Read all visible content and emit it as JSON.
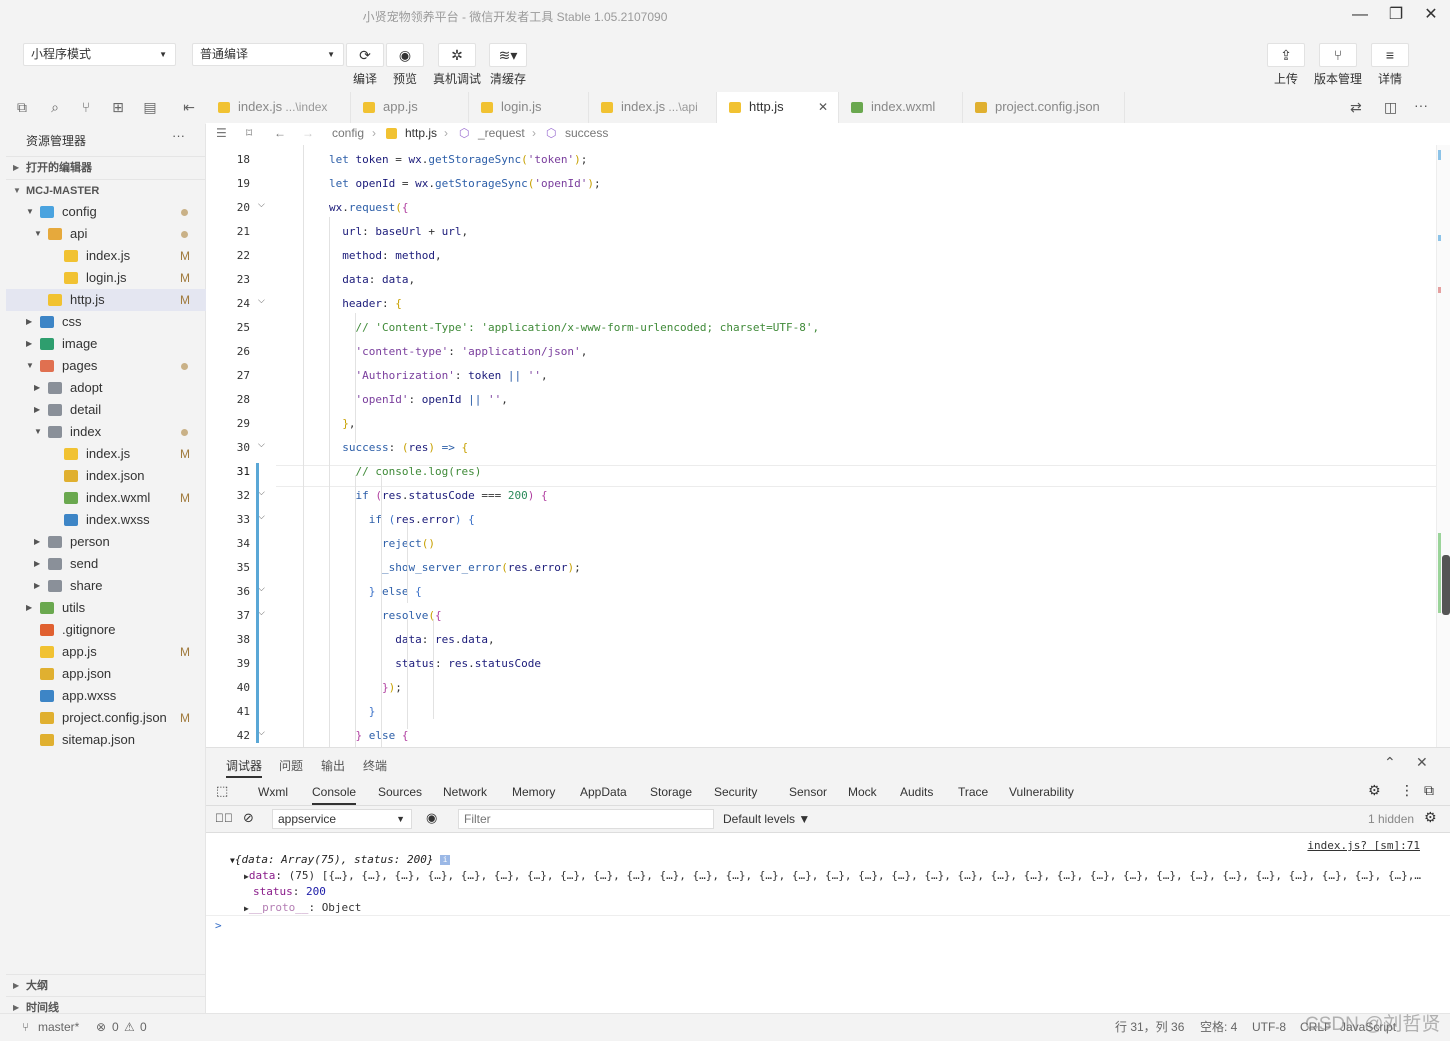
{
  "window": {
    "title": "小贤宠物领养平台 - 微信开发者工具 Stable 1.05.2107090"
  },
  "toolbar": {
    "mode_select": "小程序模式",
    "compile_select": "普通编译",
    "buttons": [
      {
        "label": "编译",
        "icon": "refresh-icon"
      },
      {
        "label": "预览",
        "icon": "eye-icon"
      },
      {
        "label": "真机调试",
        "icon": "bug-icon"
      },
      {
        "label": "清缓存",
        "icon": "layers-icon"
      }
    ],
    "right_buttons": [
      {
        "label": "上传",
        "icon": "upload-icon"
      },
      {
        "label": "版本管理",
        "icon": "branch-icon"
      },
      {
        "label": "详情",
        "icon": "menu-icon"
      }
    ]
  },
  "sidebar": {
    "header": "资源管理器",
    "more": "···",
    "open_editors": "打开的编辑器",
    "project": "MCJ-MASTER",
    "tree": [
      {
        "label": "config",
        "depth": 0,
        "kind": "folder-config",
        "open": true,
        "dot": true
      },
      {
        "label": "api",
        "depth": 1,
        "kind": "folder-api",
        "open": true,
        "dot": true
      },
      {
        "label": "index.js",
        "depth": 2,
        "kind": "js",
        "status": "M"
      },
      {
        "label": "login.js",
        "depth": 2,
        "kind": "js",
        "status": "M"
      },
      {
        "label": "http.js",
        "depth": 1,
        "kind": "js",
        "status": "M",
        "selected": true
      },
      {
        "label": "css",
        "depth": 0,
        "kind": "folder-css",
        "open": false
      },
      {
        "label": "image",
        "depth": 0,
        "kind": "folder-image",
        "open": false
      },
      {
        "label": "pages",
        "depth": 0,
        "kind": "folder-pages",
        "open": true,
        "dot": true
      },
      {
        "label": "adopt",
        "depth": 1,
        "kind": "folder",
        "open": false
      },
      {
        "label": "detail",
        "depth": 1,
        "kind": "folder",
        "open": false
      },
      {
        "label": "index",
        "depth": 1,
        "kind": "folder",
        "open": true,
        "dot": true
      },
      {
        "label": "index.js",
        "depth": 2,
        "kind": "js",
        "status": "M"
      },
      {
        "label": "index.json",
        "depth": 2,
        "kind": "json"
      },
      {
        "label": "index.wxml",
        "depth": 2,
        "kind": "wxml",
        "status": "M"
      },
      {
        "label": "index.wxss",
        "depth": 2,
        "kind": "wxss"
      },
      {
        "label": "person",
        "depth": 1,
        "kind": "folder",
        "open": false
      },
      {
        "label": "send",
        "depth": 1,
        "kind": "folder",
        "open": false
      },
      {
        "label": "share",
        "depth": 1,
        "kind": "folder",
        "open": false
      },
      {
        "label": "utils",
        "depth": 0,
        "kind": "folder-utils",
        "open": false
      },
      {
        "label": ".gitignore",
        "depth": 0,
        "kind": "git"
      },
      {
        "label": "app.js",
        "depth": 0,
        "kind": "js",
        "status": "M"
      },
      {
        "label": "app.json",
        "depth": 0,
        "kind": "json"
      },
      {
        "label": "app.wxss",
        "depth": 0,
        "kind": "wxss"
      },
      {
        "label": "project.config.json",
        "depth": 0,
        "kind": "json",
        "status": "M"
      },
      {
        "label": "sitemap.json",
        "depth": 0,
        "kind": "json"
      }
    ],
    "outline": "大纲",
    "timeline": "时间线"
  },
  "tabs": [
    {
      "label": "index.js",
      "path": "...\\index",
      "kind": "js"
    },
    {
      "label": "app.js",
      "path": "",
      "kind": "js"
    },
    {
      "label": "login.js",
      "path": "",
      "kind": "js"
    },
    {
      "label": "index.js",
      "path": "...\\api",
      "kind": "js"
    },
    {
      "label": "http.js",
      "path": "",
      "kind": "js",
      "active": true
    },
    {
      "label": "index.wxml",
      "path": "",
      "kind": "wxml"
    },
    {
      "label": "project.config.json",
      "path": "",
      "kind": "json"
    }
  ],
  "breadcrumb": [
    "config",
    "http.js",
    "_request",
    "success"
  ],
  "editor": {
    "current_line": 31,
    "lines": [
      {
        "n": 18,
        "html": "<span class='k'>let</span> <span class='p'>token</span> = <span class='p'>wx</span>.<span class='f'>getStorageSync</span><span class='br'>(</span><span class='s'>'token'</span><span class='br'>)</span>;"
      },
      {
        "n": 19,
        "html": "<span class='k'>let</span> <span class='p'>openId</span> = <span class='p'>wx</span>.<span class='f'>getStorageSync</span><span class='br'>(</span><span class='s'>'openId'</span><span class='br'>)</span>;"
      },
      {
        "n": 20,
        "html": "<span class='p'>wx</span>.<span class='f'>request</span><span class='br'>(</span><span class='br2'>{</span>",
        "fold": true
      },
      {
        "n": 21,
        "html": "  <span class='p'>url</span>: <span class='p'>baseUrl</span> + <span class='p'>url</span>,"
      },
      {
        "n": 22,
        "html": "  <span class='p'>method</span>: <span class='p'>method</span>,"
      },
      {
        "n": 23,
        "html": "  <span class='p'>data</span>: <span class='p'>data</span>,"
      },
      {
        "n": 24,
        "html": "  <span class='p'>header</span>: <span class='br'>{</span>",
        "fold": true
      },
      {
        "n": 25,
        "html": "    <span class='c'>// 'Content-Type': 'application/x-www-form-urlencoded; charset=UTF-8',</span>"
      },
      {
        "n": 26,
        "html": "    <span class='s'>'content-type'</span>: <span class='s'>'application/json'</span>,"
      },
      {
        "n": 27,
        "html": "    <span class='s'>'Authorization'</span>: <span class='p'>token</span> <span class='k'>||</span> <span class='s'>''</span>,"
      },
      {
        "n": 28,
        "html": "    <span class='s'>'openId'</span>: <span class='p'>openId</span> <span class='k'>||</span> <span class='s'>''</span>,"
      },
      {
        "n": 29,
        "html": "  <span class='br'>}</span>,"
      },
      {
        "n": 30,
        "html": "  <span class='f'>success</span>: <span class='br'>(</span><span class='p'>res</span><span class='br'>)</span> <span class='k'>=></span> <span class='br'>{</span>",
        "fold": true
      },
      {
        "n": 31,
        "html": "    <span class='c'>// console.log(res)</span>"
      },
      {
        "n": 32,
        "html": "    <span class='k'>if</span> <span class='br2'>(</span><span class='p'>res</span>.<span class='p'>statusCode</span> === <span class='n'>200</span><span class='br2'>)</span> <span class='br2'>{</span>",
        "fold": true
      },
      {
        "n": 33,
        "html": "      <span class='k'>if</span> <span class='br3'>(</span><span class='p'>res</span>.<span class='p'>error</span><span class='br3'>)</span> <span class='br3'>{</span>",
        "fold": true
      },
      {
        "n": 34,
        "html": "        <span class='f'>reject</span><span class='br'>()</span>"
      },
      {
        "n": 35,
        "html": "        <span class='f'>_show_server_error</span><span class='br'>(</span><span class='p'>res</span>.<span class='p'>error</span><span class='br'>)</span>;"
      },
      {
        "n": 36,
        "html": "      <span class='br3'>}</span> <span class='k'>else</span> <span class='br3'>{</span>",
        "fold": true
      },
      {
        "n": 37,
        "html": "        <span class='f'>resolve</span><span class='br'>(</span><span class='br2'>{</span>",
        "fold": true
      },
      {
        "n": 38,
        "html": "          <span class='p'>data</span>: <span class='p'>res</span>.<span class='p'>data</span>,"
      },
      {
        "n": 39,
        "html": "          <span class='p'>status</span>: <span class='p'>res</span>.<span class='p'>statusCode</span>"
      },
      {
        "n": 40,
        "html": "        <span class='br2'>}</span><span class='br'>)</span>;"
      },
      {
        "n": 41,
        "html": "      <span class='br3'>}</span>"
      },
      {
        "n": 42,
        "html": "    <span class='br2'>}</span> <span class='k'>else</span> <span class='br2'>{</span>",
        "fold": true
      }
    ]
  },
  "panel": {
    "tabs": [
      "调试器",
      "问题",
      "输出",
      "终端"
    ],
    "active_tab": "调试器",
    "devtools_tabs": [
      "Wxml",
      "Console",
      "Sources",
      "Network",
      "Memory",
      "AppData",
      "Storage",
      "Security",
      "Sensor",
      "Mock",
      "Audits",
      "Trace",
      "Vulnerability"
    ],
    "active_devtools_tab": "Console",
    "context_select": "appservice",
    "filter_placeholder": "Filter",
    "levels": "Default levels ▼",
    "hidden": "1 hidden",
    "console": {
      "source_link": "index.js? [sm]:71",
      "summary": "{data: Array(75), status: 200}",
      "data_line_key": "data",
      "data_line_val": "(75) [{…}, {…}, {…}, {…}, {…}, {…}, {…}, {…}, {…}, {…}, {…}, {…}, {…}, {…}, {…}, {…}, {…}, {…}, {…}, {…}, {…}, {…}, {…}, {…}, {…}, {…}, {…}, {…}, {…}, {…}, {…}, {…}, {…},…",
      "status_key": "status",
      "status_val": "200",
      "proto_key": "__proto__",
      "proto_val": "Object",
      "prompt": ">"
    }
  },
  "status": {
    "branch": "master*",
    "errors": "0",
    "warnings": "0",
    "position": "行 31，列 36",
    "spaces": "空格: 4",
    "encoding": "UTF-8",
    "eol": "CRLF",
    "language": "JavaScript",
    "watermark": "CSDN @刘哲贤"
  }
}
